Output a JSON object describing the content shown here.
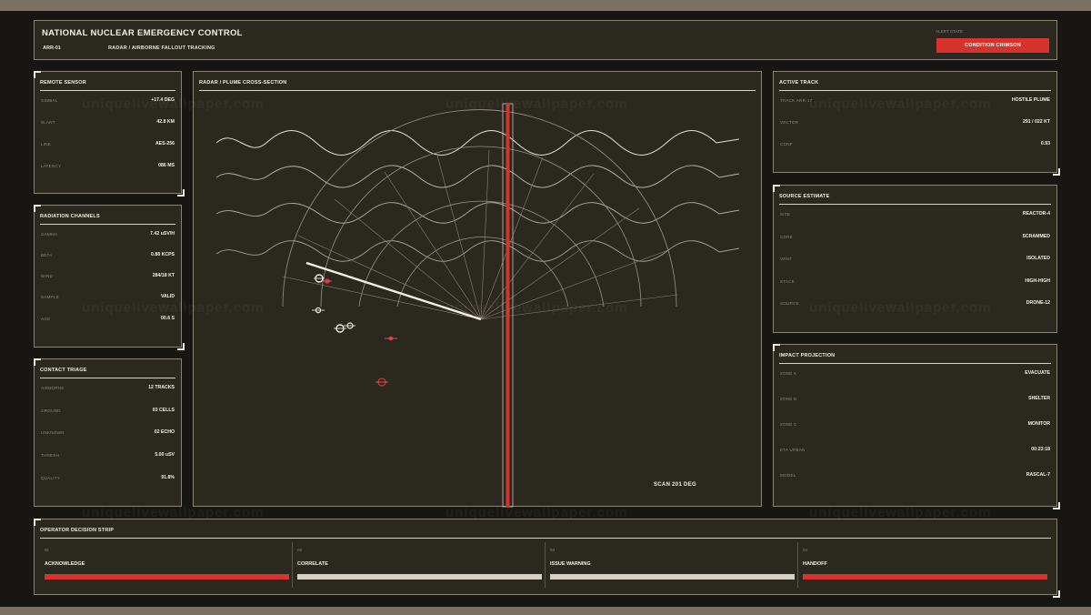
{
  "header": {
    "title": "NATIONAL NUCLEAR EMERGENCY CONTROL",
    "unit_id": "ARR-01",
    "subtitle": "RADAR / AIRBORNE FALLOUT TRACKING",
    "alert_label": "ALERT STATE",
    "alert_value": "CONDITION CRIMSON",
    "alert_color": "#d7322c"
  },
  "remote_sensor": {
    "title": "REMOTE SENSOR",
    "rows": [
      {
        "k": "GIMBAL",
        "v": "+17.4 DEG"
      },
      {
        "k": "SLANT",
        "v": "42.8 KM"
      },
      {
        "k": "LINK",
        "v": "AES-256"
      },
      {
        "k": "LATENCY",
        "v": "086 MS"
      }
    ]
  },
  "radiation_channels": {
    "title": "RADIATION CHANNELS",
    "rows": [
      {
        "k": "GAMMA",
        "v": "7.42 uSV/H"
      },
      {
        "k": "BETA",
        "v": "0.88 KCPS"
      },
      {
        "k": "WIND",
        "v": "284/18 KT"
      },
      {
        "k": "SAMPLE",
        "v": "VALID"
      },
      {
        "k": "AGE",
        "v": "00.6 S"
      }
    ]
  },
  "contact_triage": {
    "title": "CONTACT TRIAGE",
    "rows": [
      {
        "k": "AIRBORNE",
        "v": "12 TRACKS"
      },
      {
        "k": "GROUND",
        "v": "03 CELLS"
      },
      {
        "k": "UNKNOWN",
        "v": "02 ECHO"
      },
      {
        "k": "THRESH",
        "v": "5.00 uSV"
      },
      {
        "k": "QUALITY",
        "v": "91.8%"
      }
    ]
  },
  "radar": {
    "title": "RADAR / PLUME CROSS-SECTION",
    "scan_readout": "SCAN 201 DEG"
  },
  "active_track": {
    "title": "ACTIVE TRACK",
    "rows": [
      {
        "k": "TRACK ARR-17",
        "v": "HOSTILE PLUME"
      },
      {
        "k": "VECTOR",
        "v": "291 / 022 KT"
      },
      {
        "k": "CONF",
        "v": "0.93"
      }
    ]
  },
  "source_estimate": {
    "title": "SOURCE ESTIMATE",
    "rows": [
      {
        "k": "SITE",
        "v": "REACTOR-4"
      },
      {
        "k": "CORE",
        "v": "SCRAMMED"
      },
      {
        "k": "VENT",
        "v": "ISOLATED"
      },
      {
        "k": "STACK",
        "v": "HIGH-HIGH"
      },
      {
        "k": "SOURCE",
        "v": "DRONE-12"
      }
    ]
  },
  "impact_projection": {
    "title": "IMPACT PROJECTION",
    "rows": [
      {
        "k": "ZONE A",
        "v": "EVACUATE"
      },
      {
        "k": "ZONE B",
        "v": "SHELTER"
      },
      {
        "k": "ZONE C",
        "v": "MONITOR"
      },
      {
        "k": "ETA URBAN",
        "v": "00:23:18"
      },
      {
        "k": "MODEL",
        "v": "RASCAL-7"
      }
    ]
  },
  "decision_strip": {
    "title": "OPERATOR DECISION STRIP",
    "steps": [
      {
        "num": "01",
        "label": "ACKNOWLEDGE",
        "color": "#d7322c"
      },
      {
        "num": "02",
        "label": "CORRELATE",
        "color": "#d6d0c2"
      },
      {
        "num": "03",
        "label": "ISSUE WARNING",
        "color": "#d6d0c2"
      },
      {
        "num": "04",
        "label": "HANDOFF",
        "color": "#d7322c"
      }
    ]
  },
  "watermark": "uniquelivewallpaper.com"
}
